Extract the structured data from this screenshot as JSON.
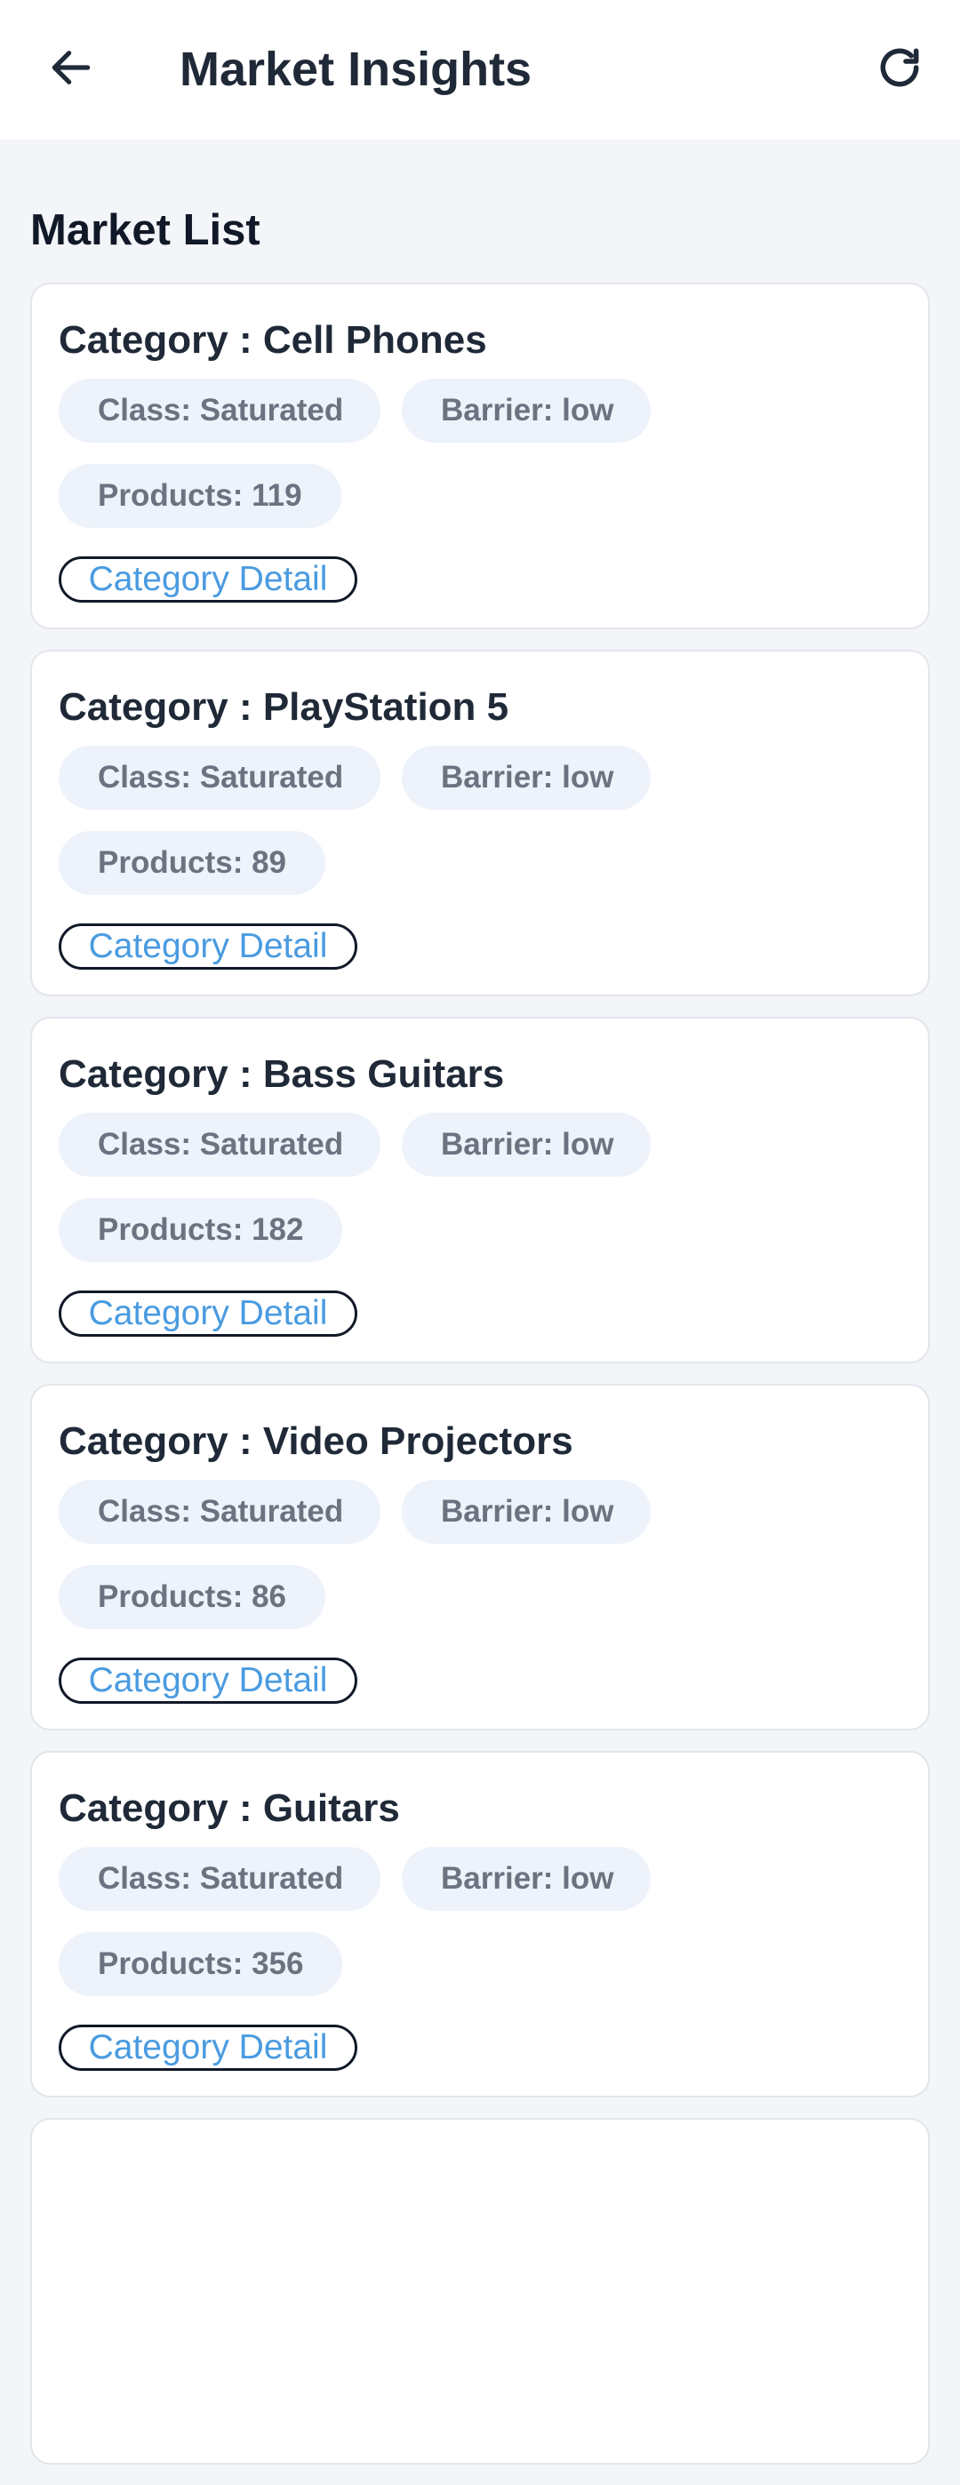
{
  "app_bar": {
    "title": "Market Insights",
    "back_icon": "arrow-left-icon",
    "refresh_icon": "refresh-icon"
  },
  "section": {
    "title": "Market List"
  },
  "colors": {
    "accent": "#4a9be0",
    "chip_bg": "#edf2fb",
    "page_bg": "#f3f5f9"
  },
  "cards": [
    {
      "title": "Category : Cell Phones",
      "class": "Class: Saturated",
      "barrier": "Barrier: low",
      "products": "Products: 119",
      "link": "Category Detail"
    },
    {
      "title": "Category : PlayStation 5",
      "class": "Class: Saturated",
      "barrier": "Barrier: low",
      "products": "Products: 89",
      "link": "Category Detail"
    },
    {
      "title": "Category : Bass Guitars",
      "class": "Class: Saturated",
      "barrier": "Barrier: low",
      "products": "Products: 182",
      "link": "Category Detail"
    },
    {
      "title": "Category : Video Projectors",
      "class": "Class: Saturated",
      "barrier": "Barrier: low",
      "products": "Products: 86",
      "link": "Category Detail"
    },
    {
      "title": "Category : Guitars",
      "class": "Class: Saturated",
      "barrier": "Barrier: low",
      "products": "Products: 356",
      "link": "Category Detail"
    }
  ]
}
